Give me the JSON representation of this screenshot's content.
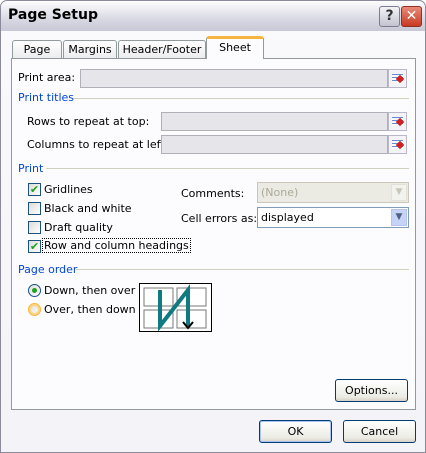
{
  "window": {
    "title": "Page Setup",
    "help_label": "?",
    "close_label": "✕"
  },
  "tabs": [
    {
      "label": "Page"
    },
    {
      "label": "Margins"
    },
    {
      "label": "Header/Footer"
    },
    {
      "label": "Sheet",
      "active": true
    }
  ],
  "print_area": {
    "label": "Print area:",
    "value": ""
  },
  "print_titles": {
    "heading": "Print titles",
    "rows_label": "Rows to repeat at top:",
    "rows_value": "",
    "cols_label": "Columns to repeat at left:",
    "cols_value": ""
  },
  "print": {
    "heading": "Print",
    "options": [
      {
        "label": "Gridlines",
        "checked": true
      },
      {
        "label": "Black and white",
        "checked": false
      },
      {
        "label": "Draft quality",
        "checked": false
      },
      {
        "label": "Row and column headings",
        "checked": true
      }
    ],
    "comments_label": "Comments:",
    "comments_value": "(None)",
    "cell_errors_label": "Cell errors as:",
    "cell_errors_value": "displayed"
  },
  "page_order": {
    "heading": "Page order",
    "options": [
      {
        "label": "Down, then over",
        "selected": true
      },
      {
        "label": "Over, then down",
        "selected": false
      }
    ]
  },
  "buttons": {
    "options": "Options...",
    "ok": "OK",
    "cancel": "Cancel"
  },
  "check_mark": "✔",
  "dropdown_glyph": "▼"
}
